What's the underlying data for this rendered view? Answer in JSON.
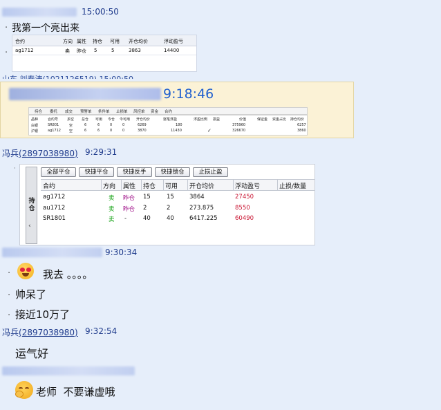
{
  "chat": {
    "m1_time": "15:00:50",
    "m1_text": "我第一个亮出来",
    "m2_partial": "山东 刘春涛(1021126519) 15:00:50",
    "m2_time": "9:18:46",
    "m3_sender_name": "冯兵",
    "m3_sender_id": "(2897038980)",
    "m3_time": "9:29:31",
    "m4_time": "9:30:34",
    "m4_text1": "我去 。。。。",
    "m4_text2": "帅呆了",
    "m4_text3": "接近10万了",
    "m5_sender_name": "冯兵",
    "m5_sender_id": "(2897038980)",
    "m5_time": "9:32:54",
    "m5_text": "运气好",
    "m6_text": "老师  不要谦虚哦",
    "bullet": "·"
  },
  "shot1": {
    "headers": [
      "合约",
      "方向",
      "属性",
      "持仓",
      "可用",
      "开仓均价",
      "浮动盈亏"
    ],
    "row": [
      "ag1712",
      "卖",
      "昨仓",
      "5",
      "5",
      "3863",
      "14400"
    ]
  },
  "shot2": {
    "tabs": [
      "持仓",
      "委托",
      "成交",
      "预警单",
      "条件单",
      "止损单",
      "风控单",
      "资金",
      "合约"
    ],
    "headers": [
      "品种",
      "合约号",
      "多空",
      "总仓",
      "可用",
      "今仓",
      "今可用",
      "开仓均价",
      "逐笔浮盈",
      "浮盈比例",
      "损益",
      "价值",
      "保证金",
      "资金占比",
      "持仓均价"
    ],
    "rows": [
      [
        "白银",
        "SR801",
        "空",
        "6",
        "6",
        "0",
        "0",
        "6269",
        "180",
        "",
        "",
        "375960",
        "",
        "",
        "6257"
      ],
      [
        "沪银",
        "ag1712",
        "空",
        "6",
        "6",
        "0",
        "0",
        "3870",
        "11430",
        "",
        "",
        "326670",
        "",
        "",
        "3860"
      ]
    ]
  },
  "shot3": {
    "side_label": "持仓",
    "buttons": [
      "全部平仓",
      "快捷平仓",
      "快捷反手",
      "快捷锁仓",
      "止损止盈"
    ],
    "headers": [
      "合约",
      "方向",
      "属性",
      "持仓",
      "可用",
      "开仓均价",
      "浮动盈亏",
      "止损/数量"
    ],
    "rows": [
      [
        "ag1712",
        "卖",
        "昨仓",
        "15",
        "15",
        "3864",
        "27450",
        ""
      ],
      [
        "au1712",
        "卖",
        "昨仓",
        "2",
        "2",
        "273.875",
        "8550",
        ""
      ],
      [
        "SR1801",
        "卖",
        "-",
        "40",
        "40",
        "6417.225",
        "60490",
        ""
      ]
    ]
  },
  "colors": {
    "sell": "#17a317",
    "profit": "#c8102e",
    "time": "#1f3b8c",
    "bigtime": "#1f5fcf"
  }
}
